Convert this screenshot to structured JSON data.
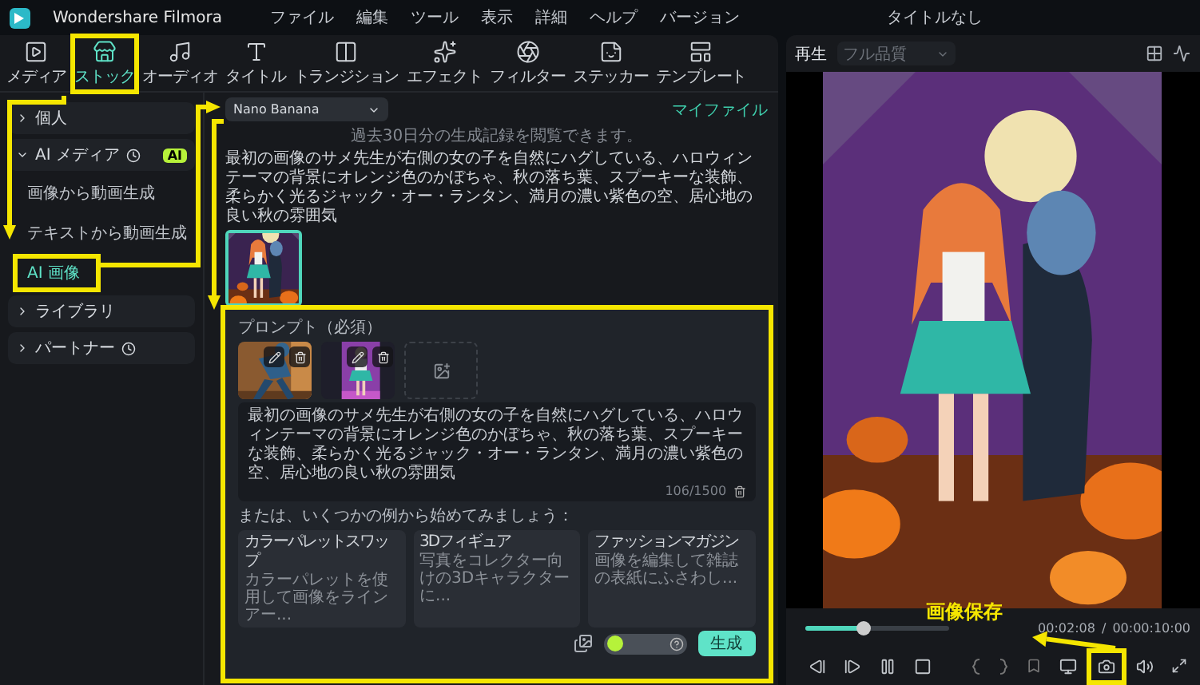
{
  "app": {
    "name": "Wondershare Filmora",
    "menu": [
      "ファイル",
      "編集",
      "ツール",
      "表示",
      "詳細",
      "ヘルプ",
      "バージョン"
    ],
    "title": "タイトルなし"
  },
  "toolbar": [
    {
      "label": "メディア",
      "selected": false,
      "highlighted": false
    },
    {
      "label": "ストック",
      "selected": true,
      "highlighted": true
    },
    {
      "label": "オーディオ",
      "selected": false,
      "highlighted": false
    },
    {
      "label": "タイトル",
      "selected": false,
      "highlighted": false
    },
    {
      "label": "トランジション",
      "selected": false,
      "highlighted": false
    },
    {
      "label": "エフェクト",
      "selected": false,
      "highlighted": false
    },
    {
      "label": "フィルター",
      "selected": false,
      "highlighted": false
    },
    {
      "label": "ステッカー",
      "selected": false,
      "highlighted": false
    },
    {
      "label": "テンプレート",
      "selected": false,
      "highlighted": false
    }
  ],
  "sidebar": [
    {
      "label": "個人",
      "expanded": false,
      "has_icon": false
    },
    {
      "label": "AI メディア",
      "expanded": true,
      "has_icon": true,
      "badge": "AI",
      "children": [
        {
          "label": "画像から動画生成",
          "selected": false,
          "highlighted": false
        },
        {
          "label": "テキストから動画生成",
          "selected": false,
          "highlighted": false
        },
        {
          "label": "AI 画像",
          "selected": true,
          "highlighted": true
        }
      ]
    },
    {
      "label": "ライブラリ",
      "expanded": false,
      "has_icon": false
    },
    {
      "label": "パートナー",
      "expanded": false,
      "has_icon": true
    }
  ],
  "generator": {
    "model": "Nano Banana",
    "my_files": "マイファイル",
    "history_note": "過去30日分の生成記録を閲覧できます。",
    "last_prompt": "最初の画像のサメ先生が右側の女の子を自然にハグしている、ハロウィンテーマの背景にオレンジ色のかぼちゃ、秋の落ち葉、スプーキーな装飾、柔らかく光るジャック・オー・ランタン、満月の濃い紫色の空、居心地の良い秋の雰囲気",
    "result": {
      "kind": "picture"
    }
  },
  "prompt_panel": {
    "title": "プロンプト（必須）",
    "highlighted": true,
    "images": [
      {
        "kind": "picture"
      },
      {
        "kind": "picture"
      },
      {
        "kind": "add"
      }
    ],
    "text": "最初の画像のサメ先生が右側の女の子を自然にハグしている、ハロウィンテーマの背景にオレンジ色のかぼちゃ、秋の落ち葉、スプーキーな装飾、柔らかく光るジャック・オー・ランタン、満月の濃い紫色の空、居心地の良い秋の雰囲気",
    "counter": "106/1500",
    "examples_hint": "または、いくつかの例から始めてみましょう：",
    "examples": [
      {
        "title": "カラーパレットスワップ",
        "desc": "カラーパレットを使用して画像をラインアー..."
      },
      {
        "title": "3Dフィギュア",
        "desc": "写真をコレクター向けの3Dキャラクターに..."
      },
      {
        "title": "ファッションマガジン",
        "desc": "画像を編集して雑誌の表紙にふさわし..."
      }
    ],
    "generate": "生成"
  },
  "player": {
    "tab": "再生",
    "quality": "フル品質",
    "level": 0.4,
    "current": "00:02:08",
    "separator": "/",
    "total": "00:00:10:00",
    "callout": "画像保存",
    "snapshot_highlighted": true
  }
}
